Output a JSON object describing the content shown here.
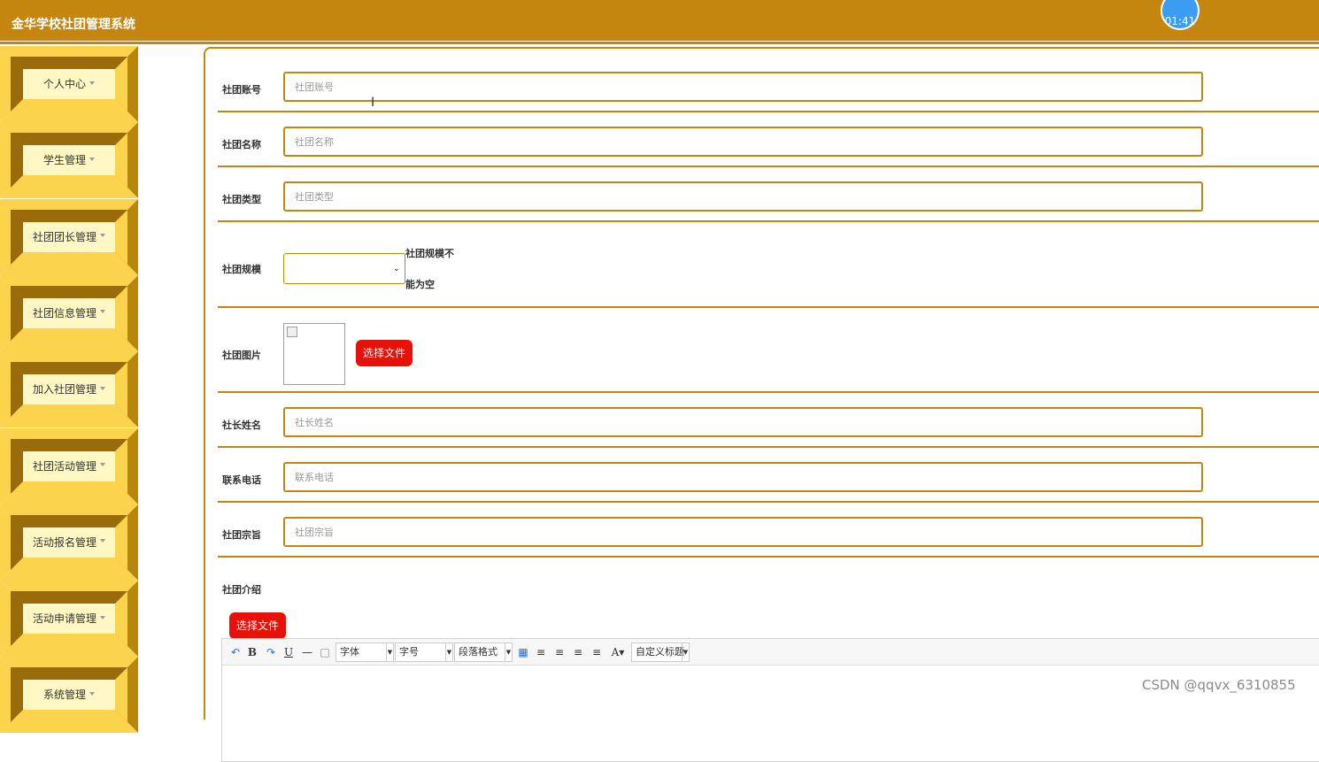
{
  "header": {
    "title": "金华学校社团管理系统",
    "clock": "01:41"
  },
  "sidebar": {
    "items": [
      {
        "label": "个人中心"
      },
      {
        "label": "学生管理"
      },
      {
        "label": "社团团长管理"
      },
      {
        "label": "社团信息管理"
      },
      {
        "label": "加入社团管理"
      },
      {
        "label": "社团活动管理"
      },
      {
        "label": "活动报名管理"
      },
      {
        "label": "活动申请管理"
      },
      {
        "label": "系统管理"
      }
    ]
  },
  "form": {
    "account": {
      "label": "社团账号",
      "placeholder": "社团账号",
      "value": ""
    },
    "name": {
      "label": "社团名称",
      "placeholder": "社团名称",
      "value": ""
    },
    "type": {
      "label": "社团类型",
      "placeholder": "社团类型",
      "value": ""
    },
    "scale": {
      "label": "社团规模",
      "selected": "",
      "warning_line1": "社团规模不",
      "warning_line2": "能为空"
    },
    "image": {
      "label": "社团图片",
      "button": "选择文件"
    },
    "leader": {
      "label": "社长姓名",
      "placeholder": "社长姓名",
      "value": ""
    },
    "phone": {
      "label": "联系电话",
      "placeholder": "联系电话",
      "value": ""
    },
    "purpose": {
      "label": "社团宗旨",
      "placeholder": "社团宗旨",
      "value": ""
    },
    "intro": {
      "label": "社团介绍",
      "button": "选择文件"
    }
  },
  "editor": {
    "font_family": "字体",
    "font_size": "字号",
    "paragraph": "段落格式",
    "custom_title": "自定义标题"
  },
  "watermark": "CSDN @qqvx_6310855"
}
